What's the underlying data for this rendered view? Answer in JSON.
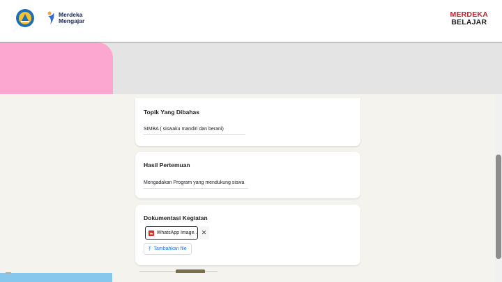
{
  "header": {
    "left_logo_name": "Merdeka Mengajar",
    "left_logo_line1": "Merdeka",
    "left_logo_line2": "Mengajar",
    "right_logo_line1": "MERDEKA",
    "right_logo_line2": "BELAJAR"
  },
  "cards": [
    {
      "title": "Topik Yang Dibahas",
      "answer": "SIMBA ( siswaku mandiri dan berani)"
    },
    {
      "title": "Hasil Pertemuan",
      "answer": "Mengadakan Program yang mendukung siswa"
    },
    {
      "title": "Dokumentasi Kegiatan",
      "file_name": "WhatsApp Image...",
      "remove_label": "✕",
      "add_file_label": "Tambahkan file",
      "upload_icon": "⤒"
    }
  ],
  "colors": {
    "pink": "#fba7d0",
    "blue": "#86c7ee",
    "cream": "#f4f3ed",
    "link_blue": "#1a73e8",
    "brand_red": "#c0202a"
  }
}
